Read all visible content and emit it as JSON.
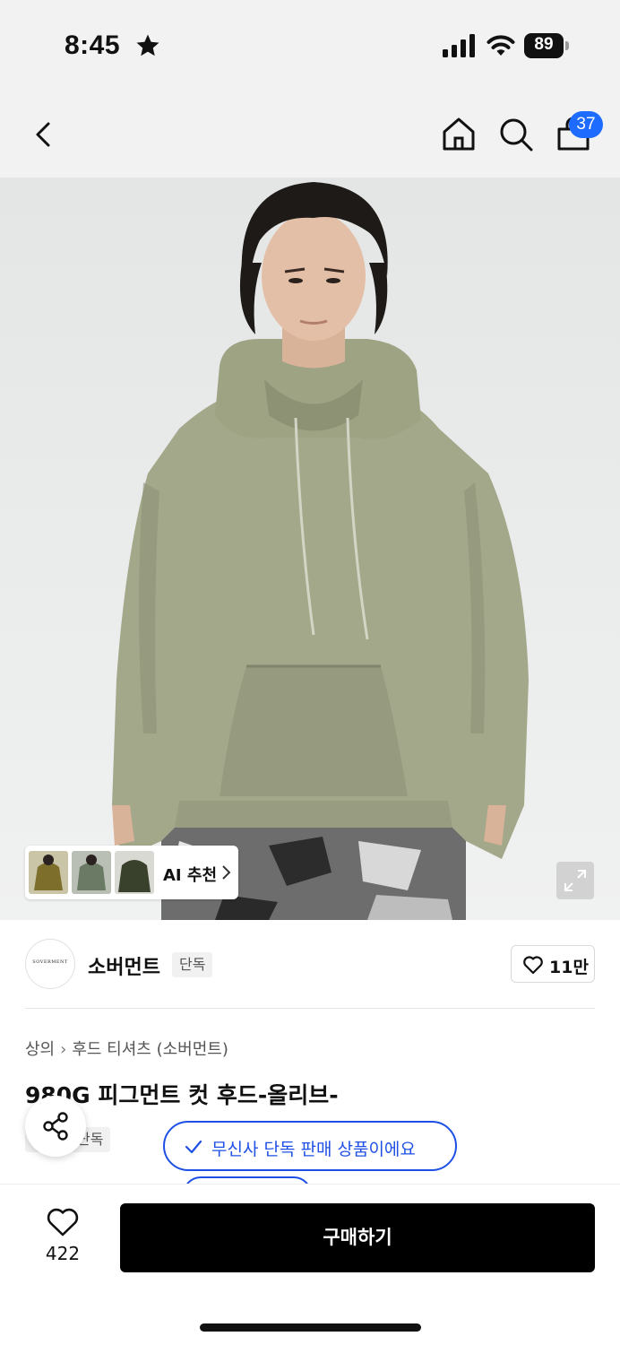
{
  "status_bar": {
    "time": "8:45",
    "battery": "89"
  },
  "nav": {
    "back_icon": "chevron-left-icon",
    "home_icon": "home-icon",
    "search_icon": "search-icon",
    "cart_icon": "shopping-bag-icon",
    "cart_count": "37"
  },
  "hero": {
    "ai_label": "AI 추천",
    "zoom_icon": "expand-icon"
  },
  "brand": {
    "logo_text": "SOVERMENT",
    "name": "소버먼트",
    "tag": "단독",
    "likes": "11만"
  },
  "breadcrumb": {
    "category": "상의",
    "subcategory": "후드 티셔츠 (소버먼트)"
  },
  "product": {
    "title": "980G 피그먼트 컷 후드-올리브-",
    "exclusive_tag": "단독"
  },
  "toast": {
    "text": "무신사 단독 판매 상품이에요"
  },
  "bottom_bar": {
    "wish_count": "422",
    "buy_label": "구매하기"
  },
  "colors": {
    "accent_blue": "#1e50e6",
    "badge_blue": "#1e6bff",
    "hoodie_olive": "#a3a88a"
  }
}
